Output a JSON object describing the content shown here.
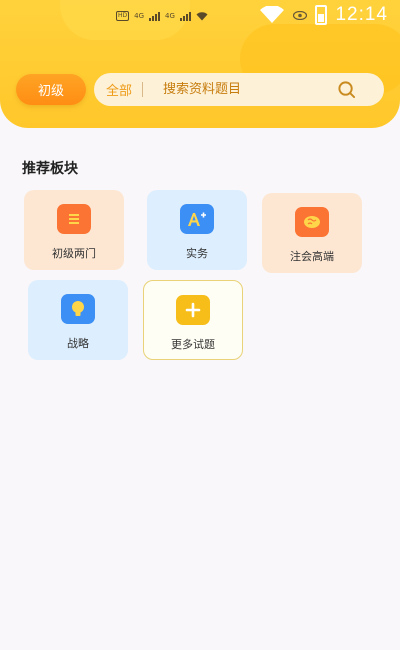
{
  "status_bar": {
    "time": "12:14",
    "network_left": "HD",
    "signal_left_a": "4G",
    "signal_left_b": "4G"
  },
  "search": {
    "level_label": "初级",
    "scope_label": "全部",
    "placeholder": "搜索资料题目"
  },
  "section": {
    "title": "推荐板块"
  },
  "tiles": [
    {
      "label": "初级两门",
      "icon": "list-icon",
      "color": "#fb7433"
    },
    {
      "label": "实务",
      "icon": "letter-a-plus-icon",
      "color": "#3c8ff5"
    },
    {
      "label": "注会高端",
      "icon": "brain-icon",
      "color": "#fb7433"
    },
    {
      "label": "战略",
      "icon": "lightbulb-icon",
      "color": "#3c8ff5"
    },
    {
      "label": "更多试题",
      "icon": "plus-icon",
      "color": "#f7be1a"
    }
  ],
  "colors": {
    "header": "#ffc72a",
    "accent_orange": "#ff8d14",
    "search_bg": "#fdf1d8"
  }
}
